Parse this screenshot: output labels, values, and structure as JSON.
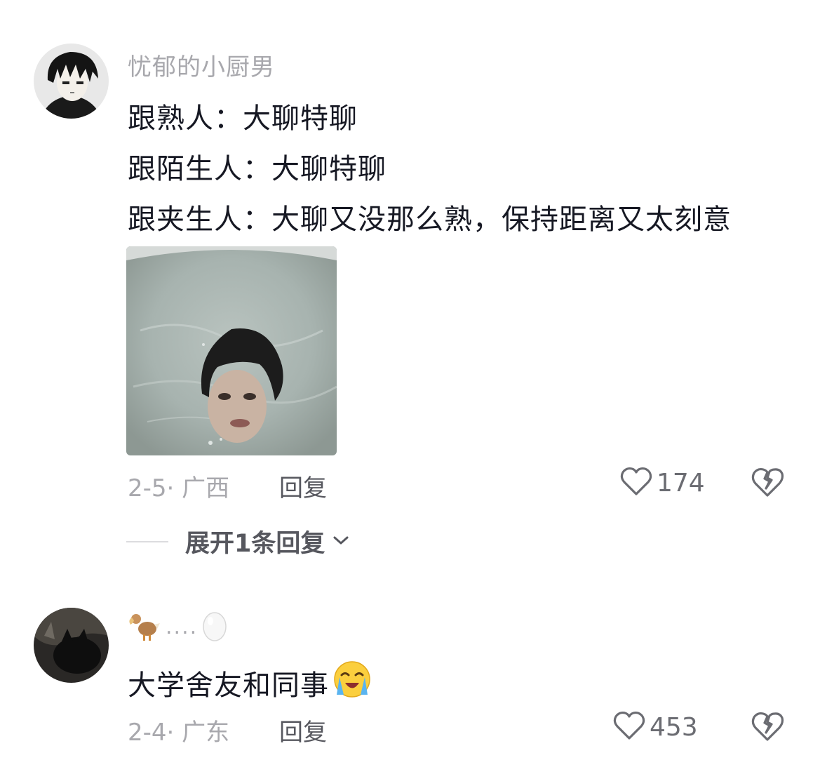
{
  "comments": [
    {
      "username": "忧郁的小厨男",
      "lines": [
        "跟熟人：大聊特聊",
        "跟陌生人：大聊特聊",
        "跟夹生人：大聊又没那么熟，保持距离又太刻意"
      ],
      "date_location": "2-5· 广西",
      "reply_label": "回复",
      "likes": "174",
      "expand_label": "展开1条回复"
    },
    {
      "username_dots": "....",
      "text": "大学舍友和同事",
      "date_location": "2-4· 广东",
      "reply_label": "回复",
      "likes": "453"
    }
  ],
  "colors": {
    "meta_gray": "#a8a8ad",
    "text": "#161823",
    "icon_gray": "#56575e"
  }
}
